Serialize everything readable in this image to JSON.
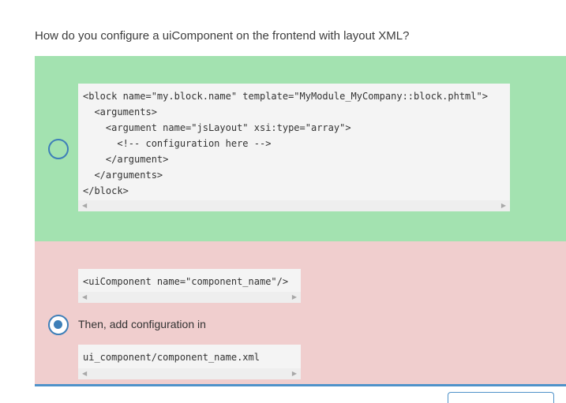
{
  "question": {
    "text": "How do you configure a uiComponent on the frontend with layout XML?"
  },
  "options": [
    {
      "state": "correct",
      "selected": false,
      "code": "<block name=\"my.block.name\" template=\"MyModule_MyCompany::block.phtml\">\n  <arguments>\n    <argument name=\"jsLayout\" xsi:type=\"array\">\n      <!-- configuration here -->\n    </argument>\n  </arguments>\n</block>"
    },
    {
      "state": "incorrect",
      "selected": true,
      "code_top": "<uiComponent name=\"component_name\"/>",
      "text": "Then, add configuration in",
      "code_bottom": "ui_component/component_name.xml"
    }
  ],
  "icons": {
    "scroll_left": "scroll-left-arrow-icon",
    "scroll_right": "scroll-right-arrow-icon",
    "left_glyph": "◀",
    "right_glyph": "▶"
  },
  "colors": {
    "correct_bg": "#a3e2b0",
    "incorrect_bg": "#f0cece",
    "accent": "#3e7fb8",
    "code_bg": "#f4f4f4"
  }
}
